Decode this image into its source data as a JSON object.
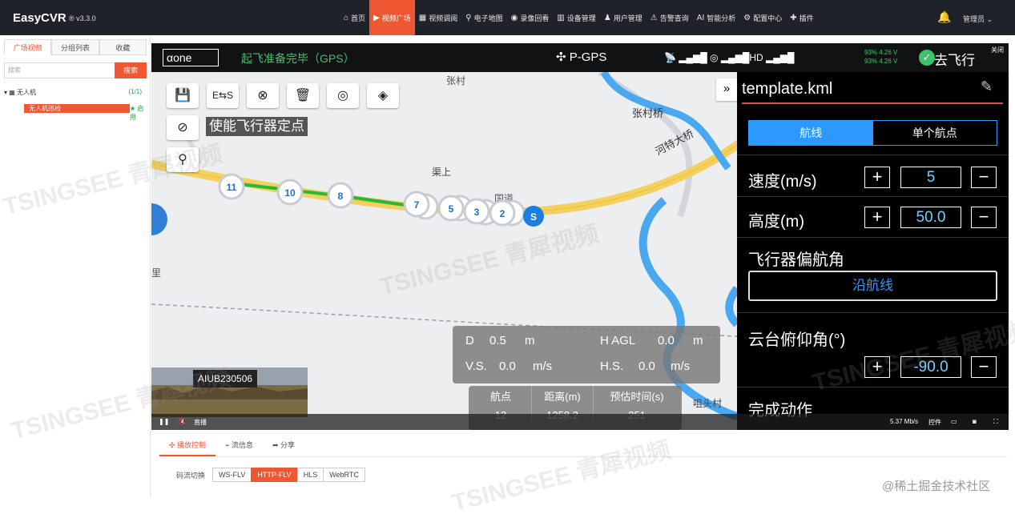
{
  "app": {
    "brand": "EasyCVR",
    "version": "® v3.3.0"
  },
  "nav": [
    {
      "icon": "home-icon",
      "glyph": "⌂",
      "label": "首页"
    },
    {
      "icon": "play-icon",
      "glyph": "▶",
      "label": "视频广场"
    },
    {
      "icon": "grid-icon",
      "glyph": "▦",
      "label": "视频调阅"
    },
    {
      "icon": "map-pin-icon",
      "glyph": "⚲",
      "label": "电子地图"
    },
    {
      "icon": "camera-icon",
      "glyph": "◉",
      "label": "录像回看"
    },
    {
      "icon": "bars-icon",
      "glyph": "▥",
      "label": "设备管理"
    },
    {
      "icon": "users-icon",
      "glyph": "♟",
      "label": "用户管理"
    },
    {
      "icon": "alarm-icon",
      "glyph": "⚠",
      "label": "告警查询"
    },
    {
      "icon": "ai-icon",
      "glyph": "AI",
      "label": "智能分析"
    },
    {
      "icon": "gear-icon",
      "glyph": "⚙",
      "label": "配置中心"
    },
    {
      "icon": "plugin-icon",
      "glyph": "✚",
      "label": "插件"
    }
  ],
  "user": {
    "name": "管理员 ⌄"
  },
  "sidebar": {
    "tabs": [
      "广场视频",
      "分组列表",
      "收藏"
    ],
    "search_placeholder": "搜索",
    "search_button": "搜索",
    "group": {
      "label": "▾ ▦   无人机",
      "count": "(1/1)"
    },
    "device": {
      "label": "无人机巡检",
      "status": "★ 启用"
    }
  },
  "hud": {
    "logo": "αone",
    "status": "起飞准备完毕（GPS）",
    "gps": "P-GPS",
    "signal": "📡 ▂▄▆█  ◎  ▂▄▆█HD ▂▄▆█",
    "battery_top": "93%  4.26 V",
    "battery_bottom": "93%  4.26 V",
    "go": "去飞行",
    "close": "关闭"
  },
  "toolbar": {
    "enable_label": "使能飞行器定点"
  },
  "map": {
    "labels": [
      "张村",
      "张村桥",
      "河特大桥",
      "渠上",
      "国道",
      "里",
      "咀头村"
    ],
    "waypoints": [
      "11",
      "10",
      "8",
      "7",
      "5",
      "3",
      "2",
      "S"
    ]
  },
  "panel": {
    "filename": "template.kml",
    "tab_route": "航线",
    "tab_single": "单个航点",
    "speed_label": "速度(m/s)",
    "speed_value": "5",
    "height_label": "高度(m)",
    "height_value": "50.0",
    "yaw_label": "飞行器偏航角",
    "yaw_value": "沿航线",
    "gimbal_label": "云台俯仰角(°)",
    "gimbal_value": "-90.0",
    "finish_label": "完成动作",
    "plus": "+",
    "minus": "−"
  },
  "telemetry": {
    "d_label": "D",
    "d_value": "0.5",
    "d_unit": "m",
    "hagl_label": "H AGL",
    "hagl_value": "0.0",
    "hagl_unit": "m",
    "vs_label": "V.S.",
    "vs_value": "0.0",
    "vs_unit": "m/s",
    "hs_label": "H.S.",
    "hs_value": "0.0",
    "hs_unit": "m/s"
  },
  "stats": {
    "waypoints_label": "航点",
    "waypoints_value": "12",
    "distance_label": "距离(m)",
    "distance_value": "1258.2",
    "time_label": "预估时间(s)",
    "time_value": "251"
  },
  "camera": {
    "label": "AIUB230506"
  },
  "controls": {
    "pause": "❚❚",
    "mute": "🔇",
    "live": "直播",
    "bitrate": "5.37 Mb/s",
    "ptz": "控件"
  },
  "lower": {
    "tabs": [
      "✣ 播放控制",
      "⌁ 流信息",
      "➦ 分享"
    ],
    "stream_label": "码流切换",
    "streams": [
      "WS-FLV",
      "HTTP-FLV",
      "HLS",
      "WebRTC"
    ]
  },
  "watermark": {
    "text": "TSINGSEE 青犀视频"
  },
  "credit": "@稀土掘金技术社区",
  "colors": {
    "accent": "#ef5632",
    "dark": "#1f2329",
    "panel_blue": "#2b99ff",
    "hud_green": "#3ec36a"
  }
}
